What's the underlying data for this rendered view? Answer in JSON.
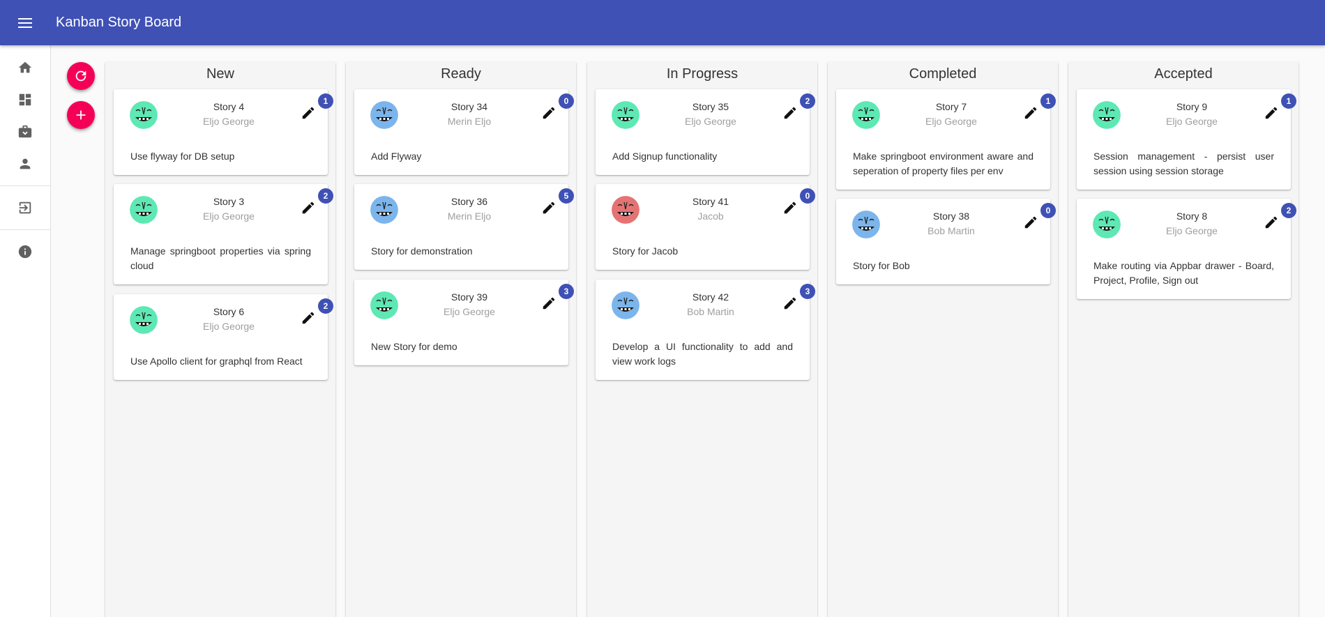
{
  "app": {
    "title": "Kanban Story Board"
  },
  "colors": {
    "appbar": "#3f51b5",
    "fab": "#f50057",
    "badge": "#3f51b5",
    "avatar_green": "#5ee8b4",
    "avatar_blue": "#7cb5ec",
    "avatar_red": "#e57373"
  },
  "sidebar": {
    "items": [
      {
        "name": "home",
        "icon": "home-icon"
      },
      {
        "name": "dashboard",
        "icon": "dashboard-icon"
      },
      {
        "name": "projects",
        "icon": "work-icon"
      },
      {
        "name": "profile",
        "icon": "person-icon"
      },
      {
        "name": "sign-out",
        "icon": "exit-icon"
      },
      {
        "name": "info",
        "icon": "info-icon"
      }
    ]
  },
  "actions": {
    "refresh_icon": "refresh-icon",
    "add_icon": "add-icon"
  },
  "columns": [
    {
      "title": "New",
      "cards": [
        {
          "title": "Story 4",
          "owner": "Eljo George",
          "badge": "1",
          "desc": "Use flyway for DB setup",
          "avatar": "green"
        },
        {
          "title": "Story 3",
          "owner": "Eljo George",
          "badge": "2",
          "desc": "Manage springboot properties via spring cloud",
          "avatar": "green"
        },
        {
          "title": "Story 6",
          "owner": "Eljo George",
          "badge": "2",
          "desc": "Use Apollo client for graphql from React",
          "avatar": "green"
        }
      ]
    },
    {
      "title": "Ready",
      "cards": [
        {
          "title": "Story 34",
          "owner": "Merin Eljo",
          "badge": "0",
          "desc": "Add Flyway",
          "avatar": "blue"
        },
        {
          "title": "Story 36",
          "owner": "Merin Eljo",
          "badge": "5",
          "desc": "Story for demonstration",
          "avatar": "blue"
        },
        {
          "title": "Story 39",
          "owner": "Eljo George",
          "badge": "3",
          "desc": "New Story for demo",
          "avatar": "green"
        }
      ]
    },
    {
      "title": "In Progress",
      "cards": [
        {
          "title": "Story 35",
          "owner": "Eljo George",
          "badge": "2",
          "desc": "Add Signup functionality",
          "avatar": "green"
        },
        {
          "title": "Story 41",
          "owner": "Jacob",
          "badge": "0",
          "desc": "Story for Jacob",
          "avatar": "red"
        },
        {
          "title": "Story 42",
          "owner": "Bob Martin",
          "badge": "3",
          "desc": "Develop a UI functionality to add and view work logs",
          "avatar": "blue2"
        }
      ]
    },
    {
      "title": "Completed",
      "cards": [
        {
          "title": "Story 7",
          "owner": "Eljo George",
          "badge": "1",
          "desc": "Make springboot environment aware and seperation of property files per env",
          "avatar": "green"
        },
        {
          "title": "Story 38",
          "owner": "Bob Martin",
          "badge": "0",
          "desc": "Story for Bob",
          "avatar": "blue2"
        }
      ]
    },
    {
      "title": "Accepted",
      "cards": [
        {
          "title": "Story 9",
          "owner": "Eljo George",
          "badge": "1",
          "desc": "Session management - persist user session using session storage",
          "avatar": "green"
        },
        {
          "title": "Story 8",
          "owner": "Eljo George",
          "badge": "2",
          "desc": "Make routing via Appbar drawer - Board, Project, Profile, Sign out",
          "avatar": "green"
        }
      ]
    }
  ]
}
